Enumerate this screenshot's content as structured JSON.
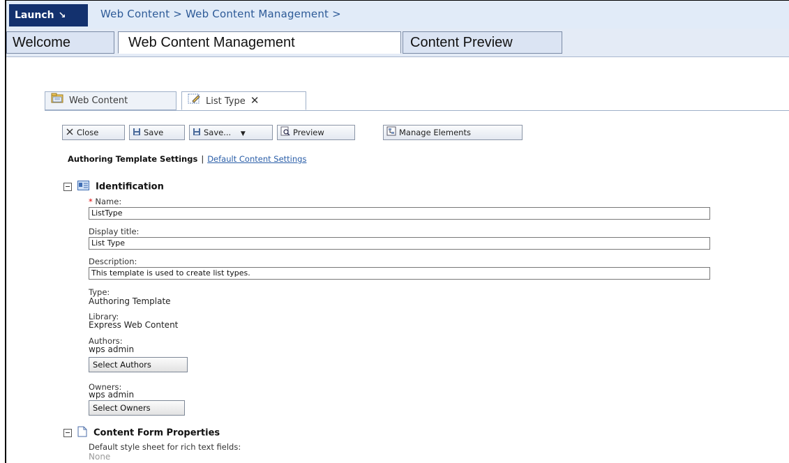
{
  "launch": {
    "label": "Launch",
    "arrow": "↘"
  },
  "breadcrumb": "Web Content > Web Content Management >",
  "page_tabs": [
    {
      "label": "Welcome"
    },
    {
      "label": "Web Content Management"
    },
    {
      "label": "Content Preview"
    }
  ],
  "content_tabs": [
    {
      "label": "Web Content",
      "icon": "folder-icon"
    },
    {
      "label": "List Type",
      "icon": "edit-template-icon",
      "close": "✕"
    }
  ],
  "toolbar": {
    "close": "Close",
    "save": "Save",
    "save_as": "Save...",
    "preview": "Preview",
    "manage": "Manage Elements"
  },
  "settings": {
    "active": "Authoring Template Settings",
    "separator": "|",
    "link": "Default Content Settings"
  },
  "identification": {
    "title": "Identification",
    "required_mark": "*",
    "name_label": "Name:",
    "name_value": "ListType",
    "display_title_label": "Display title:",
    "display_title_value": "List Type",
    "description_label": "Description:",
    "description_value": "This template is used to create list types.",
    "type_label": "Type:",
    "type_value": "Authoring Template",
    "library_label": "Library:",
    "library_value": "Express Web Content",
    "authors_label": "Authors:",
    "authors_value": "wps admin",
    "select_authors": "Select Authors",
    "owners_label": "Owners:",
    "owners_value": "wps admin",
    "select_owners": "Select Owners"
  },
  "content_form": {
    "title": "Content Form Properties",
    "stylesheet_label": "Default style sheet for rich text fields:",
    "stylesheet_value": "None"
  },
  "colors": {
    "launch_bg": "#13316e",
    "link": "#2a5ea8",
    "breadcrumb": "#2d5a97",
    "required": "#dd0000"
  }
}
